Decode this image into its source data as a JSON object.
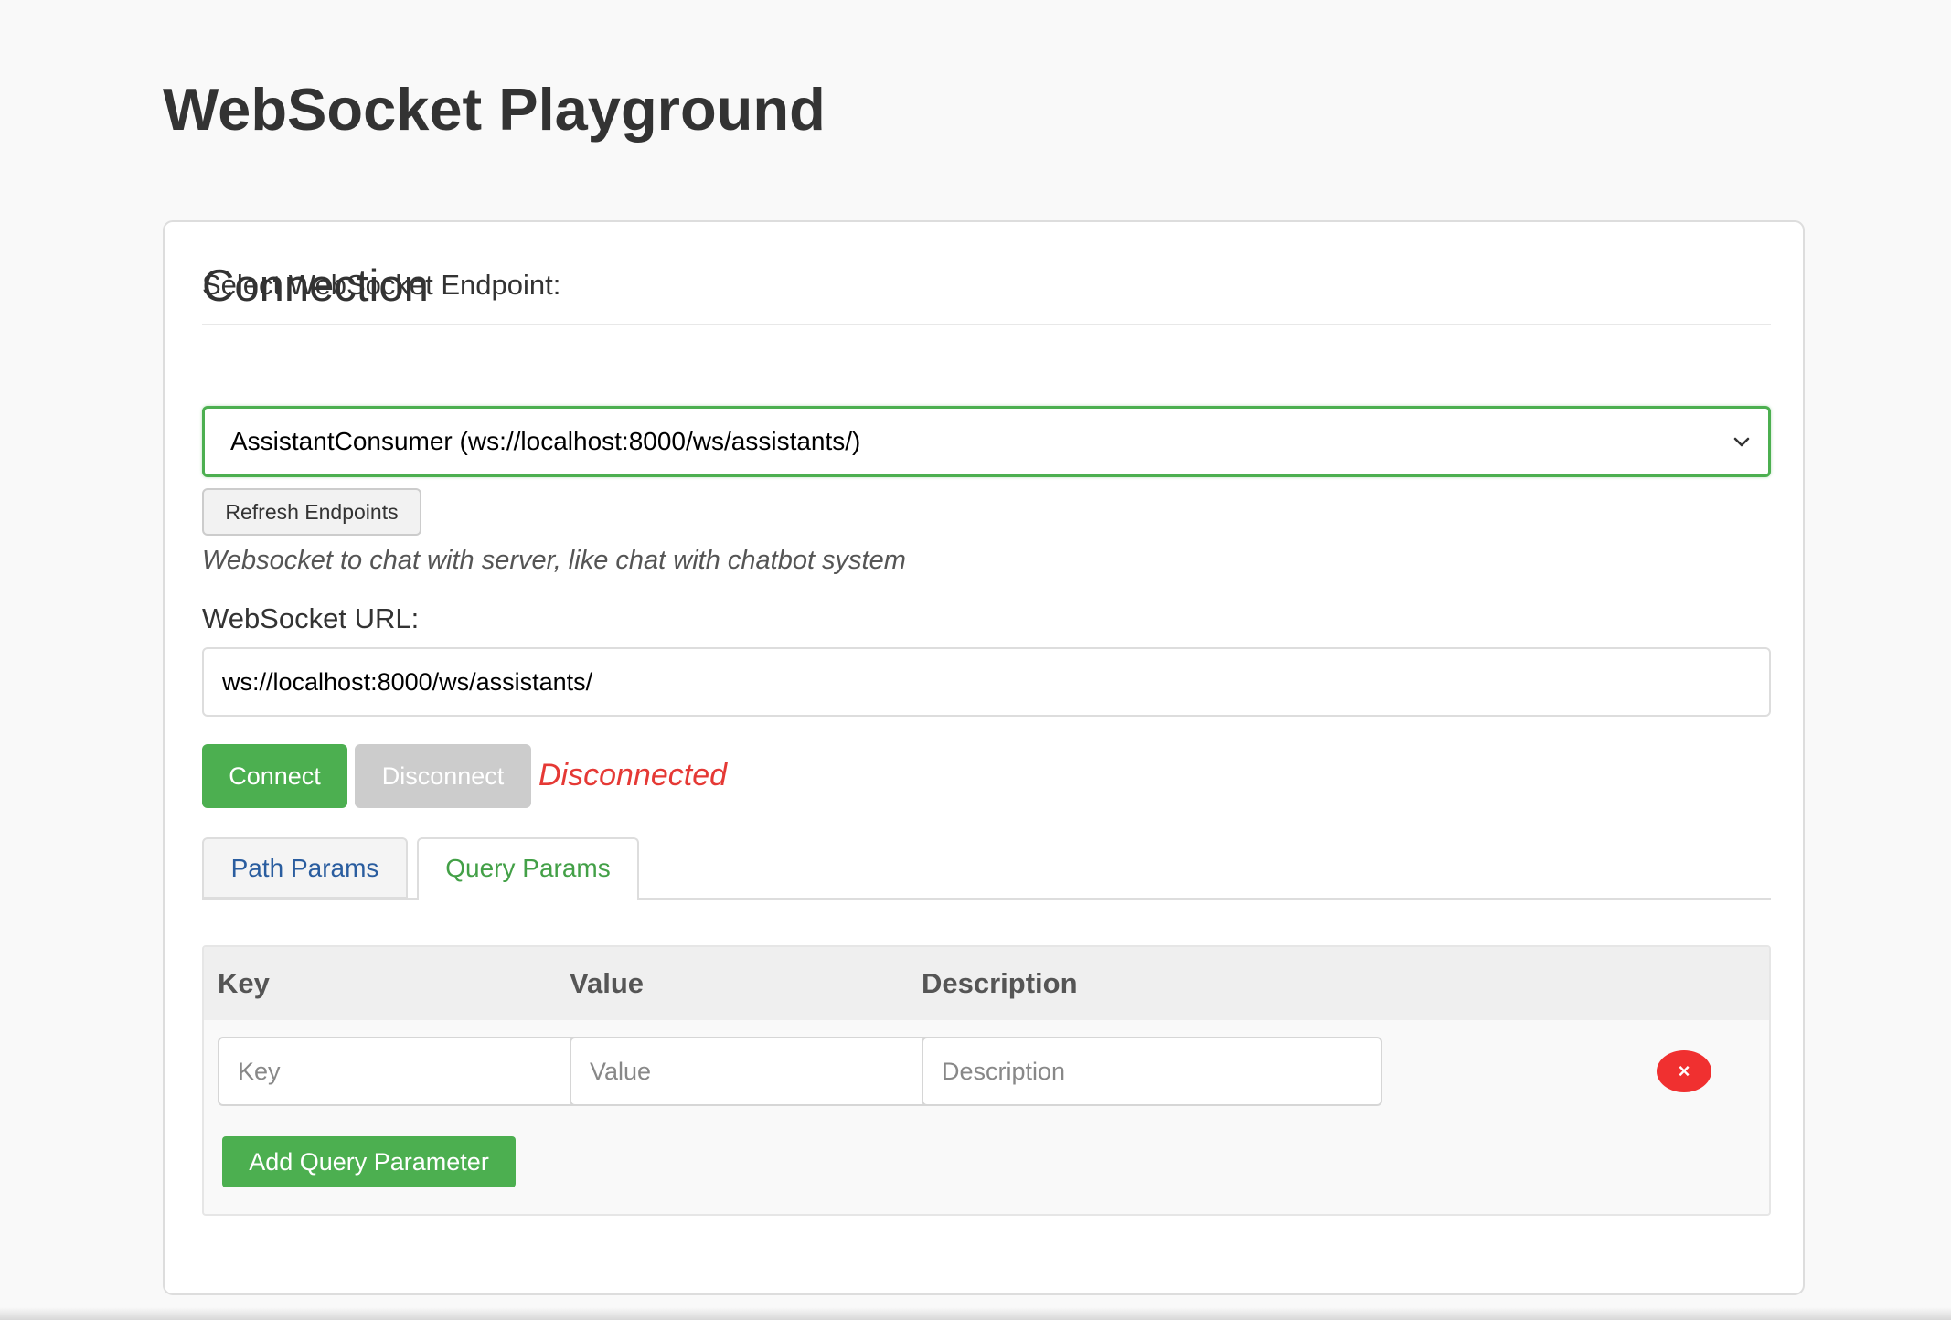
{
  "page": {
    "title": "WebSocket Playground"
  },
  "connection": {
    "section_title": "Connection",
    "endpoint_label": "Select WebSocket Endpoint:",
    "endpoint_selected": "AssistantConsumer (ws://localhost:8000/ws/assistants/)",
    "refresh_label": "Refresh Endpoints",
    "endpoint_description": "Websocket to chat with server, like chat with chatbot system",
    "url_label": "WebSocket URL:",
    "url_value": "ws://localhost:8000/ws/assistants/",
    "connect_label": "Connect",
    "disconnect_label": "Disconnect",
    "status": "Disconnected"
  },
  "tabs": [
    {
      "label": "Path Params",
      "active": false
    },
    {
      "label": "Query Params",
      "active": true
    }
  ],
  "query_params": {
    "columns": [
      "Key",
      "Value",
      "Description"
    ],
    "rows": [
      {
        "key": "",
        "value": "",
        "description": ""
      }
    ],
    "placeholders": {
      "key": "Key",
      "value": "Value",
      "description": "Description"
    },
    "delete_icon": "×",
    "add_label": "Add Query Parameter"
  },
  "colors": {
    "accent": "#4caf50",
    "status_disconnected": "#e53935",
    "delete": "#f03030",
    "tab_inactive_text": "#2a5d9f",
    "tab_active_text": "#43a047"
  }
}
